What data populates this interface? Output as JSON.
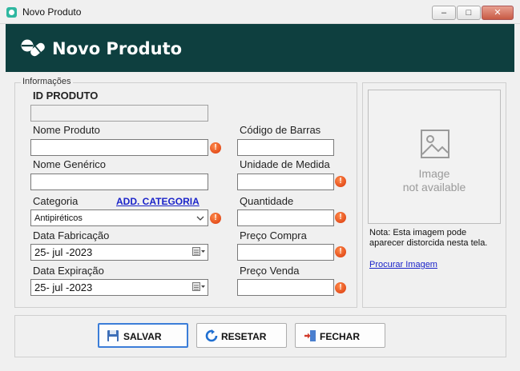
{
  "window": {
    "title": "Novo Produto",
    "minimize_glyph": "‒",
    "maximize_glyph": "□",
    "close_glyph": "✕"
  },
  "header": {
    "title": "Novo Produto",
    "icon": "pills-icon"
  },
  "form": {
    "group_label": "Informações",
    "id_label": "ID PRODUTO",
    "id_value": "",
    "nome_label": "Nome Produto",
    "nome_value": "",
    "generico_label": "Nome Genérico",
    "generico_value": "",
    "categoria_label": "Categoria",
    "add_categoria_link": "ADD. CATEGORIA",
    "categoria_value": "Antipiréticos",
    "fabricacao_label": "Data Fabricação",
    "fabricacao_value": "25- jul -2023",
    "expiracao_label": "Data Expiração",
    "expiracao_value": "25- jul -2023",
    "barras_label": "Código de Barras",
    "barras_value": "",
    "unidade_label": "Unidade de Medida",
    "unidade_value": "",
    "quantidade_label": "Quantidade",
    "quantidade_value": "",
    "compra_label": "Preço Compra",
    "compra_value": "",
    "venda_label": "Preço Venda",
    "venda_value": "",
    "error_glyph": "!"
  },
  "image_panel": {
    "placeholder_line1": "Image",
    "placeholder_line2": "not available",
    "note": "Nota: Esta imagem pode aparecer distorcida nesta tela.",
    "browse_link": "Procurar Imagem"
  },
  "buttons": {
    "save_label": "SALVAR",
    "reset_label": "RESETAR",
    "close_label": "FECHAR"
  },
  "colors": {
    "header_bg": "#0e3f3f",
    "error_icon": "#d9360a",
    "link": "#1a23c9",
    "focus_border": "#3b7dd8"
  }
}
